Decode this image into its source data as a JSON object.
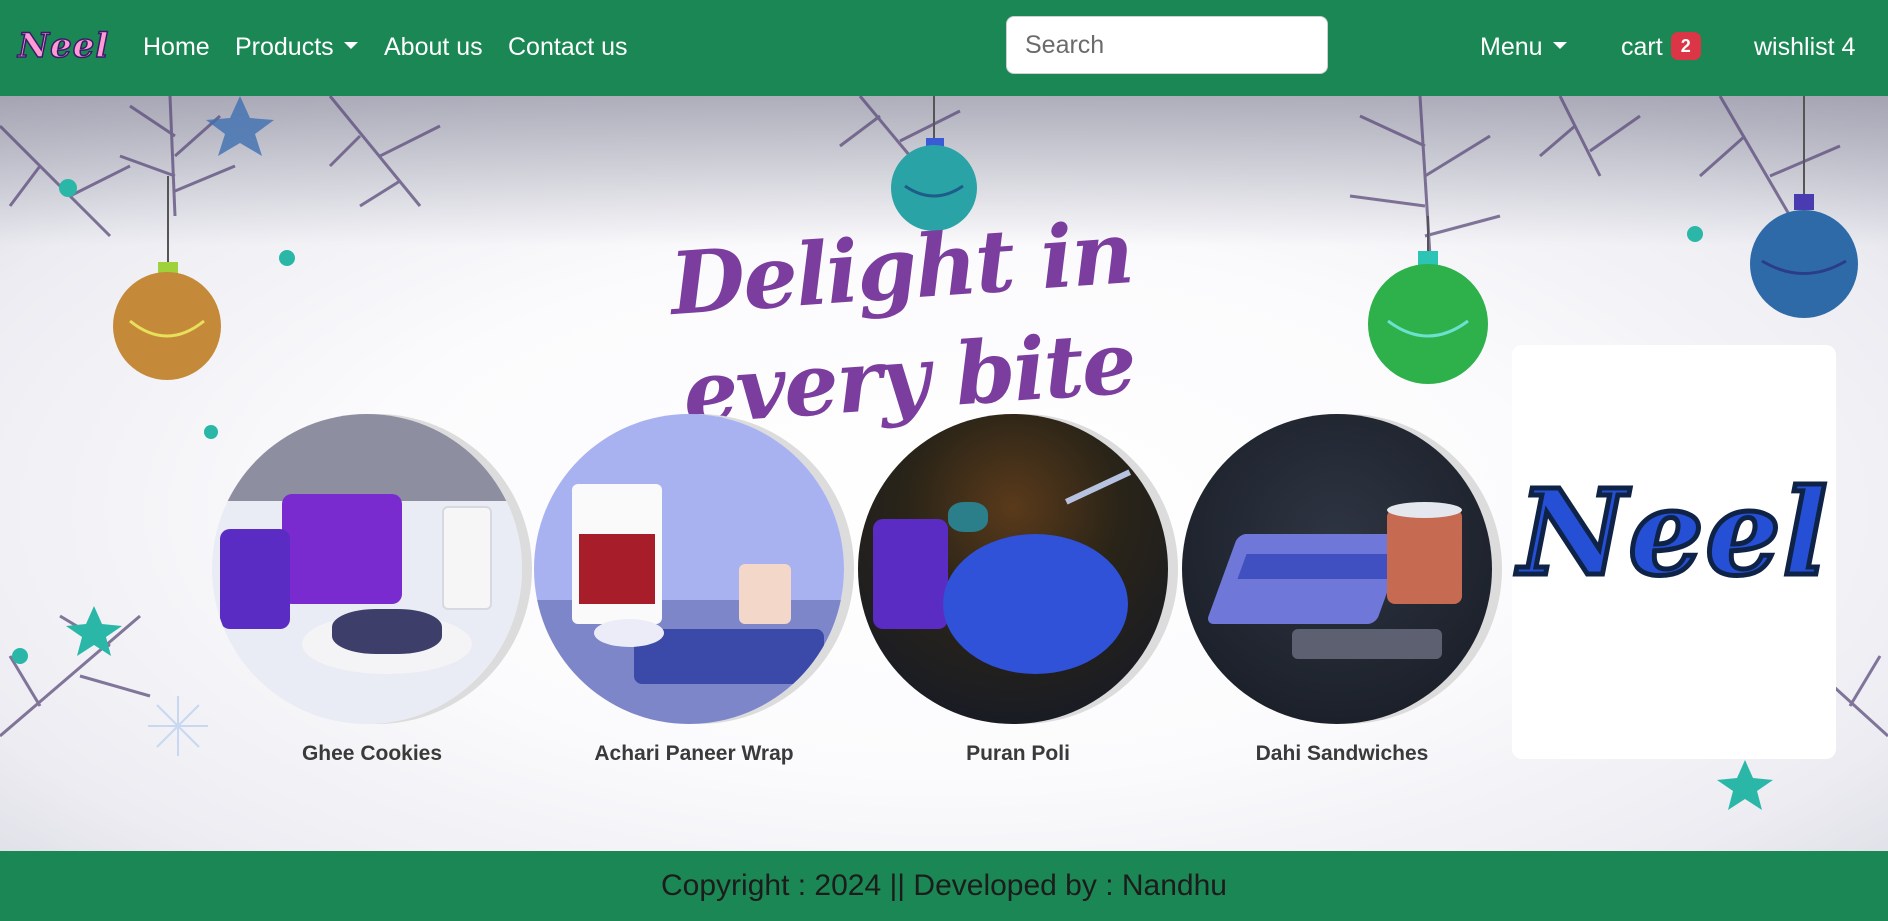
{
  "nav": {
    "brand": "Neel",
    "links": [
      "Home",
      "Products",
      "About us",
      "Contact us"
    ],
    "search_placeholder": "Search",
    "menu_label": "Menu",
    "cart_label": "cart",
    "cart_count": "2",
    "wishlist_label": "wishlist 4"
  },
  "hero": {
    "tagline": "Delight in every bite",
    "products": [
      {
        "name": "Ghee Cookies"
      },
      {
        "name": "Achari Paneer Wrap"
      },
      {
        "name": "Puran Poli"
      },
      {
        "name": "Dahi Sandwiches"
      }
    ],
    "side_logo": "Neel"
  },
  "footer": {
    "text": "Copyright : 2024 || Developed by : Nandhu"
  },
  "colors": {
    "navbar": "#1b8754",
    "badge": "#dc3545",
    "tagline": "#7b3d9e",
    "logo_blue": "#2550d6",
    "logo_green": "#2fd58a"
  }
}
